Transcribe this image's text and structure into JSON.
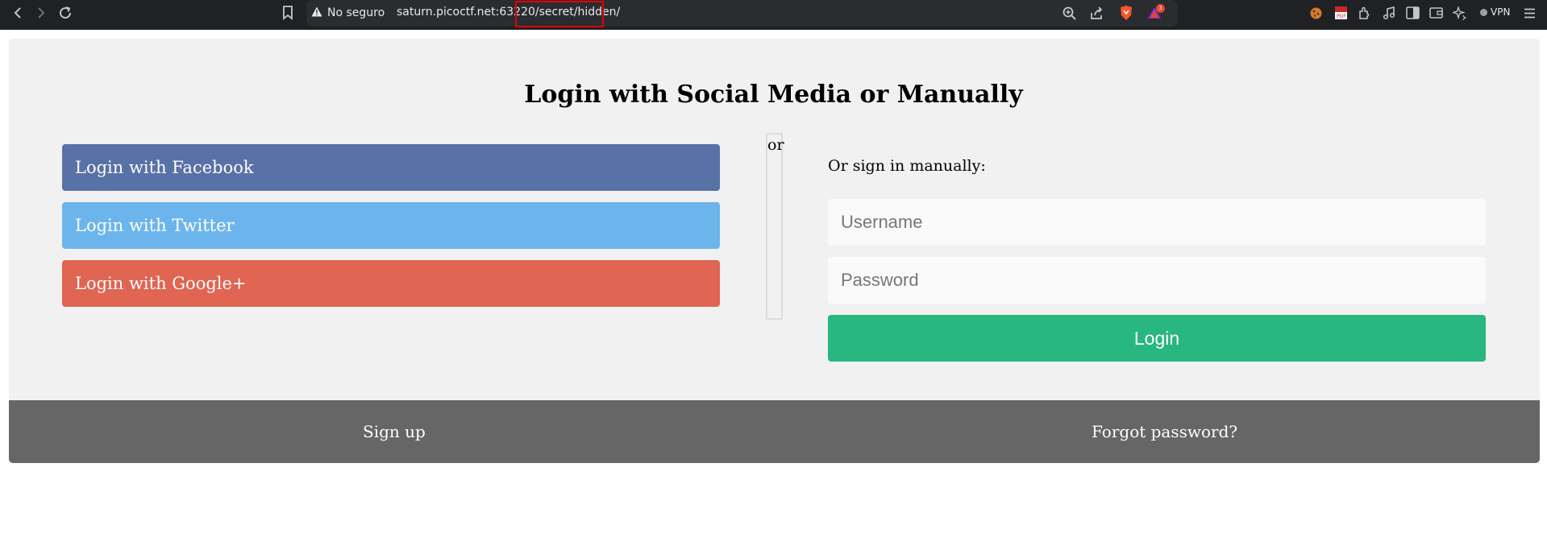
{
  "browser": {
    "security_label": "No seguro",
    "url_host": "saturn.picoctf.net:63220",
    "url_path": "/secret/hidden/",
    "vpn_label": "VPN",
    "notification_count": "3"
  },
  "page": {
    "title": "Login with Social Media or Manually",
    "social": {
      "facebook_label": "Login with Facebook",
      "twitter_label": "Login with Twitter",
      "google_label": "Login with Google+"
    },
    "divider_text": "or",
    "manual": {
      "label": "Or sign in manually:",
      "username_placeholder": "Username",
      "password_placeholder": "Password",
      "login_label": "Login"
    },
    "footer": {
      "signup_label": "Sign up",
      "forgot_label": "Forgot password?"
    }
  },
  "colors": {
    "facebook": "#5871a7",
    "twitter": "#6cb5ec",
    "google": "#e06553",
    "login": "#28b681",
    "footer": "#666666",
    "card": "#f1f1f1"
  }
}
